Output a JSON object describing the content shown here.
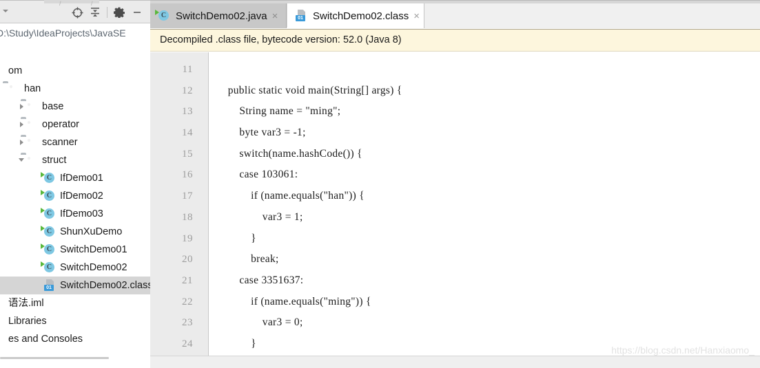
{
  "sidebar": {
    "toolbar": {
      "icons": [
        {
          "name": "locate-target-icon",
          "glyph": "target"
        },
        {
          "name": "collapse-all-icon",
          "glyph": "collapse"
        },
        {
          "name": "settings-gear-icon",
          "glyph": "gear"
        },
        {
          "name": "minimize-icon",
          "glyph": "minus"
        }
      ]
    },
    "path": "D:\\Study\\IdeaProjects\\JavaSE",
    "tree": [
      {
        "label": "om",
        "depth": 0,
        "arrow": "none",
        "icon": "none",
        "selected": false
      },
      {
        "label": "han",
        "depth": 0,
        "arrow": "none",
        "icon": "pkg",
        "selected": false
      },
      {
        "label": "base",
        "depth": 1,
        "arrow": "collapsed",
        "icon": "pkg",
        "selected": false
      },
      {
        "label": "operator",
        "depth": 1,
        "arrow": "collapsed",
        "icon": "pkg",
        "selected": false
      },
      {
        "label": "scanner",
        "depth": 1,
        "arrow": "collapsed",
        "icon": "pkg",
        "selected": false
      },
      {
        "label": "struct",
        "depth": 1,
        "arrow": "expanded",
        "icon": "pkg",
        "selected": false
      },
      {
        "label": "IfDemo01",
        "depth": 2,
        "arrow": "none",
        "icon": "java",
        "selected": false
      },
      {
        "label": "IfDemo02",
        "depth": 2,
        "arrow": "none",
        "icon": "java",
        "selected": false
      },
      {
        "label": "IfDemo03",
        "depth": 2,
        "arrow": "none",
        "icon": "java",
        "selected": false
      },
      {
        "label": "ShunXuDemo",
        "depth": 2,
        "arrow": "none",
        "icon": "java",
        "selected": false
      },
      {
        "label": "SwitchDemo01",
        "depth": 2,
        "arrow": "none",
        "icon": "java",
        "selected": false
      },
      {
        "label": "SwitchDemo02",
        "depth": 2,
        "arrow": "none",
        "icon": "java",
        "selected": false
      },
      {
        "label": "SwitchDemo02.class",
        "depth": 2,
        "arrow": "none",
        "icon": "class",
        "selected": true
      },
      {
        "label": "语法.iml",
        "depth": 0,
        "arrow": "none",
        "icon": "none",
        "selected": false
      },
      {
        "label": "Libraries",
        "depth": 0,
        "arrow": "none",
        "icon": "none",
        "selected": false
      },
      {
        "label": "es and Consoles",
        "depth": 0,
        "arrow": "none",
        "icon": "none",
        "selected": false
      }
    ]
  },
  "editor": {
    "tabs": [
      {
        "label": "SwitchDemo02.java",
        "icon": "java",
        "active": false,
        "close": "×"
      },
      {
        "label": "SwitchDemo02.class",
        "icon": "class",
        "active": true,
        "close": "×"
      }
    ],
    "notice": "Decompiled .class file, bytecode version: 52.0 (Java 8)",
    "line_numbers": [
      "11",
      "12",
      "13",
      "14",
      "15",
      "16",
      "17",
      "18",
      "19",
      "20",
      "21",
      "22",
      "23",
      "24"
    ],
    "code_lines": [
      "",
      "    public static void main(String[] args) {",
      "        String name = \"ming\";",
      "        byte var3 = -1;",
      "        switch(name.hashCode()) {",
      "        case 103061:",
      "            if (name.equals(\"han\")) {",
      "                var3 = 1;",
      "            }",
      "            break;",
      "        case 3351637:",
      "            if (name.equals(\"ming\")) {",
      "                var3 = 0;",
      "            }"
    ]
  },
  "watermark": "https://blog.csdn.net/Hanxiaomo_",
  "colors": {
    "notice_bg": "#fdf6dd",
    "gutter_bg": "#ebebeb",
    "tabbar_bg": "#d6d6d6",
    "selection_bg": "#d5d5d5",
    "java_icon": "#7ec8e3",
    "class_badge": "#3a9ad9",
    "run_triangle": "#59b83c"
  }
}
